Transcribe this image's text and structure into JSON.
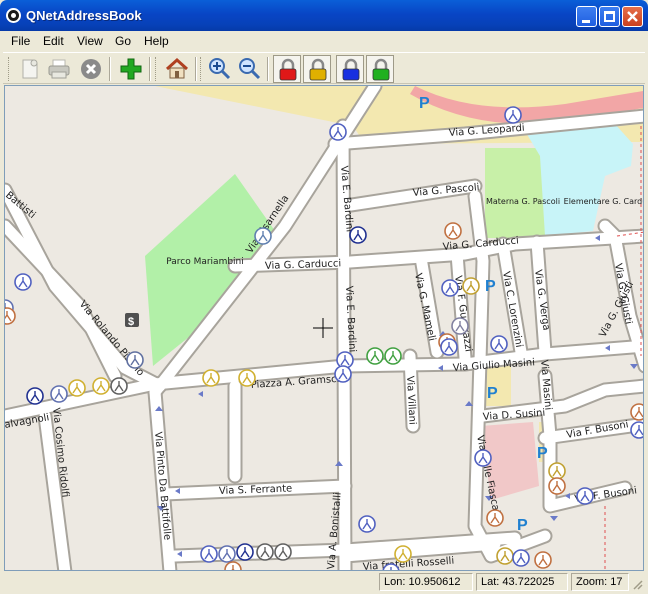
{
  "window": {
    "title": "QNetAddressBook"
  },
  "menu": [
    "File",
    "Edit",
    "View",
    "Go",
    "Help"
  ],
  "toolbar": {
    "buttons": [
      "new-contact",
      "print",
      "stop",
      "add",
      "home",
      "zoom-in",
      "zoom-out"
    ],
    "locks": [
      {
        "name": "lock-red",
        "color": "#e01818"
      },
      {
        "name": "lock-yellow",
        "color": "#e0b000"
      },
      {
        "name": "lock-blue",
        "color": "#1830e0"
      },
      {
        "name": "lock-green",
        "color": "#20b020"
      }
    ]
  },
  "map": {
    "streets": [
      "Via G. Leopardi",
      "Via G. Pascoli",
      "Via E. Bardini",
      "Via Bisarnella",
      "Via G. Carducci",
      "Via G. Carducci",
      "Via Rolando Pisano",
      "Via E. Bardini",
      "Via G. Mameli",
      "Via F. Guerrazzi",
      "Via C. Lorenzini",
      "Via G. Verga",
      "Via G. Giusti",
      "Via G. Giusti",
      "Piazza A. Gramsci",
      "Via Giulio Masini",
      "Via Villani",
      "Via D. Susini",
      "Via Masini",
      "Via F. Busoni",
      "Via F. Busoni",
      "Via Cosimo Ridolfi",
      "Via Pinto Da Battifolle",
      "Via S. Ferrante",
      "Via A. Bonistalli",
      "Via fratelli Rosselli",
      "Via delle Fiascaie",
      "Battisti",
      "alvagnoli"
    ],
    "places": [
      "Parco Mariambini",
      "Materna G. Pascoli",
      "Elementare G. Carducci"
    ],
    "parking_label": "P",
    "bank_label": "$"
  },
  "status": {
    "lon": "Lon: 10.950612",
    "lat": "Lat: 43.722025",
    "zoom": "Zoom: 17"
  }
}
